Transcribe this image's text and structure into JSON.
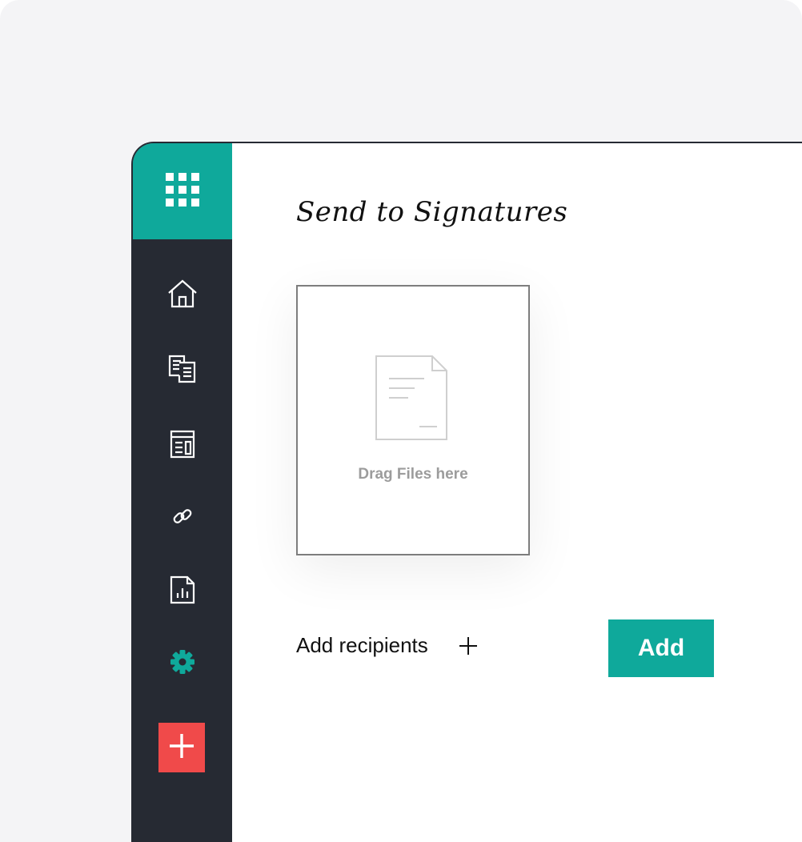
{
  "colors": {
    "accent": "#0fa99b",
    "sidebar": "#262a33",
    "create": "#f04a4a"
  },
  "sidebar": {
    "top_icon": "app-grid-icon",
    "items": [
      {
        "icon": "home-icon"
      },
      {
        "icon": "documents-icon"
      },
      {
        "icon": "templates-icon"
      },
      {
        "icon": "link-icon"
      },
      {
        "icon": "reports-icon"
      },
      {
        "icon": "settings-icon",
        "active": true
      }
    ],
    "create_icon": "plus-icon"
  },
  "main": {
    "title": "Send to Signatures",
    "drop_zone": {
      "icon": "document-icon",
      "text": "Drag Files here"
    },
    "recipients": {
      "label": "Add recipients",
      "icon": "plus-icon"
    },
    "add_button": "Add"
  }
}
